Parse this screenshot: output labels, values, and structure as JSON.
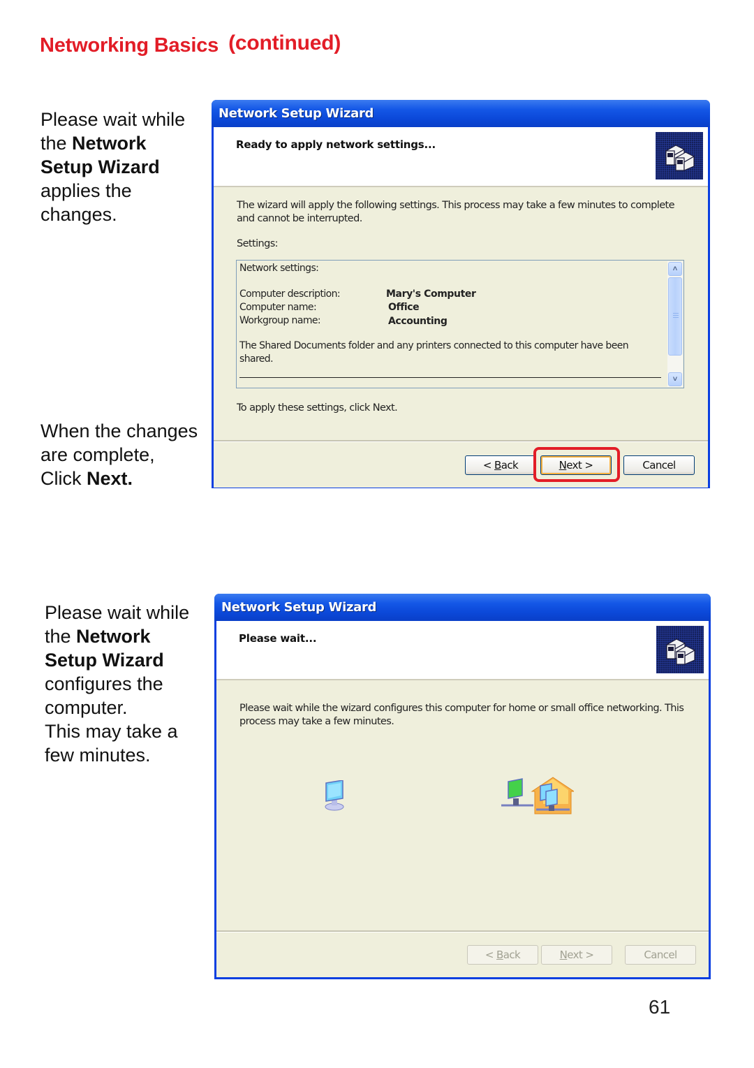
{
  "page": {
    "heading": "Networking Basics",
    "heading_suffix": "(continued)",
    "heading_color": "#e21d27",
    "page_number": "61"
  },
  "section1": {
    "instruction": {
      "line1": "Please wait while",
      "line2_plain": "the ",
      "line2_bold": "Network",
      "line3_bold": "Setup Wizard",
      "line4": "applies the",
      "line5": "changes."
    },
    "instruction2": {
      "line1": "When the changes",
      "line2": "are complete,",
      "line3_plain": "Click ",
      "line3_bold": "Next."
    },
    "dialog": {
      "title": "Network Setup Wizard",
      "header_title": "Ready to apply network settings...",
      "header_icon": "network-computers-icon",
      "intro_line1": "The wizard will apply the following settings. This process may take a few minutes to complete",
      "intro_line2": "and cannot be interrupted.",
      "settings_label": "Settings:",
      "settings": {
        "heading": "Network settings:",
        "rows": [
          {
            "label": "Computer description:",
            "value": "Mary's Computer"
          },
          {
            "label": "Computer name:",
            "value": "Office"
          },
          {
            "label": "Workgroup name:",
            "value": "Accounting"
          }
        ],
        "shared_line1": "The Shared Documents folder and any printers connected to this computer have been",
        "shared_line2": "shared."
      },
      "apply_hint": "To apply these settings, click Next.",
      "buttons": {
        "back": {
          "prefix": "< ",
          "accel": "B",
          "rest": "ack"
        },
        "next": {
          "accel": "N",
          "rest": "ext >"
        },
        "cancel": "Cancel"
      },
      "highlighted_button": "next",
      "highlight_color": "#e21d27"
    }
  },
  "section2": {
    "instruction": {
      "line1": "Please wait while",
      "line2_plain": "the ",
      "line2_bold": "Network",
      "line3_bold": "Setup Wizard",
      "line4": "configures the",
      "line5": "computer.",
      "line6": "This may take a",
      "line7": "few minutes."
    },
    "dialog": {
      "title": "Network Setup Wizard",
      "header_title": "Please wait...",
      "header_icon": "network-computers-icon",
      "intro_line1": "Please wait while the wizard configures this computer for home or small office networking. This",
      "intro_line2": "process may take a few minutes.",
      "animation": {
        "source_icon": "computer-icon",
        "target_icon": "home-network-icon"
      },
      "buttons": {
        "back": {
          "prefix": "< ",
          "accel": "B",
          "rest": "ack"
        },
        "next": {
          "accel": "N",
          "rest": "ext >"
        },
        "cancel": "Cancel"
      },
      "buttons_state": "disabled"
    }
  }
}
